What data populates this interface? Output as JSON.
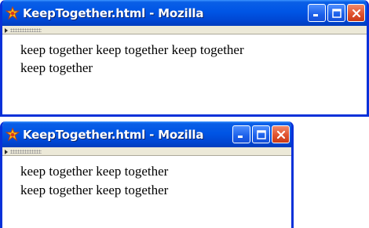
{
  "windows": [
    {
      "title": "KeepTogether.html - Mozilla",
      "lines": [
        "keep together keep together keep together",
        "keep together"
      ]
    },
    {
      "title": "KeepTogether.html - Mozilla",
      "lines": [
        "keep together keep together",
        "keep together keep together"
      ]
    }
  ],
  "icons": {
    "app": "mozilla-icon",
    "minimize": "minimize-icon",
    "maximize": "maximize-icon",
    "close": "close-icon"
  },
  "colors": {
    "titlebar": "#0055e5",
    "frame": "#0831d9",
    "close_button": "#e0532f",
    "toolbar": "#ece9d8"
  }
}
